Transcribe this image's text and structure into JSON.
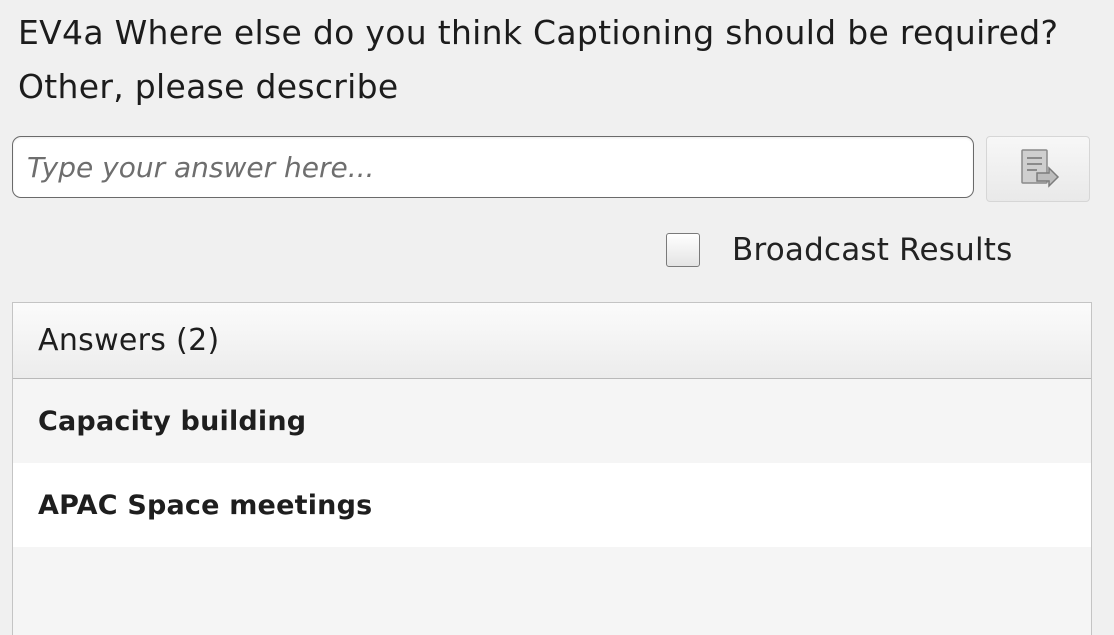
{
  "question": {
    "text": "EV4a Where else do you think Captioning should be required? Other, please describe"
  },
  "answer_input": {
    "placeholder": "Type your answer here...",
    "value": ""
  },
  "submit": {
    "icon": "submit-answer-icon"
  },
  "broadcast": {
    "label": "Broadcast Results",
    "checked": false
  },
  "answers": {
    "header": "Answers (2)",
    "items": [
      {
        "text": "Capacity building"
      },
      {
        "text": "APAC Space meetings"
      }
    ]
  },
  "colors": {
    "background": "#f0f0f0",
    "input_background": "#ffffff",
    "row_alt": "#ffffff",
    "border": "#c4c4c4"
  }
}
